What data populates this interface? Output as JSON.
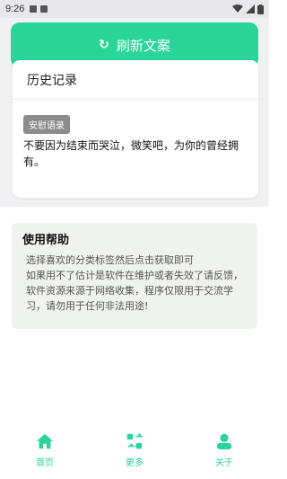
{
  "status_bar": {
    "time": "9:26"
  },
  "refresh_button": {
    "label": "刷新文案",
    "icon": "refresh-icon"
  },
  "history": {
    "title": "历史记录",
    "tag": "安慰语录",
    "quote": "不要因为结束而哭泣，微笑吧，为你的曾经拥有。"
  },
  "help": {
    "title": "使用帮助",
    "lines": [
      "选择喜欢的分类标签然后点击获取即可",
      "如果用不了估计是软件在维护或者失效了请反馈，软件资源来源于网络收集，程序仅限用于交流学习，请勿用于任何非法用途!"
    ]
  },
  "nav": [
    {
      "label": "首页",
      "icon": "home-icon"
    },
    {
      "label": "更多",
      "icon": "more-icon"
    },
    {
      "label": "关于",
      "icon": "about-icon"
    }
  ],
  "colors": {
    "accent": "#2bd59a"
  }
}
